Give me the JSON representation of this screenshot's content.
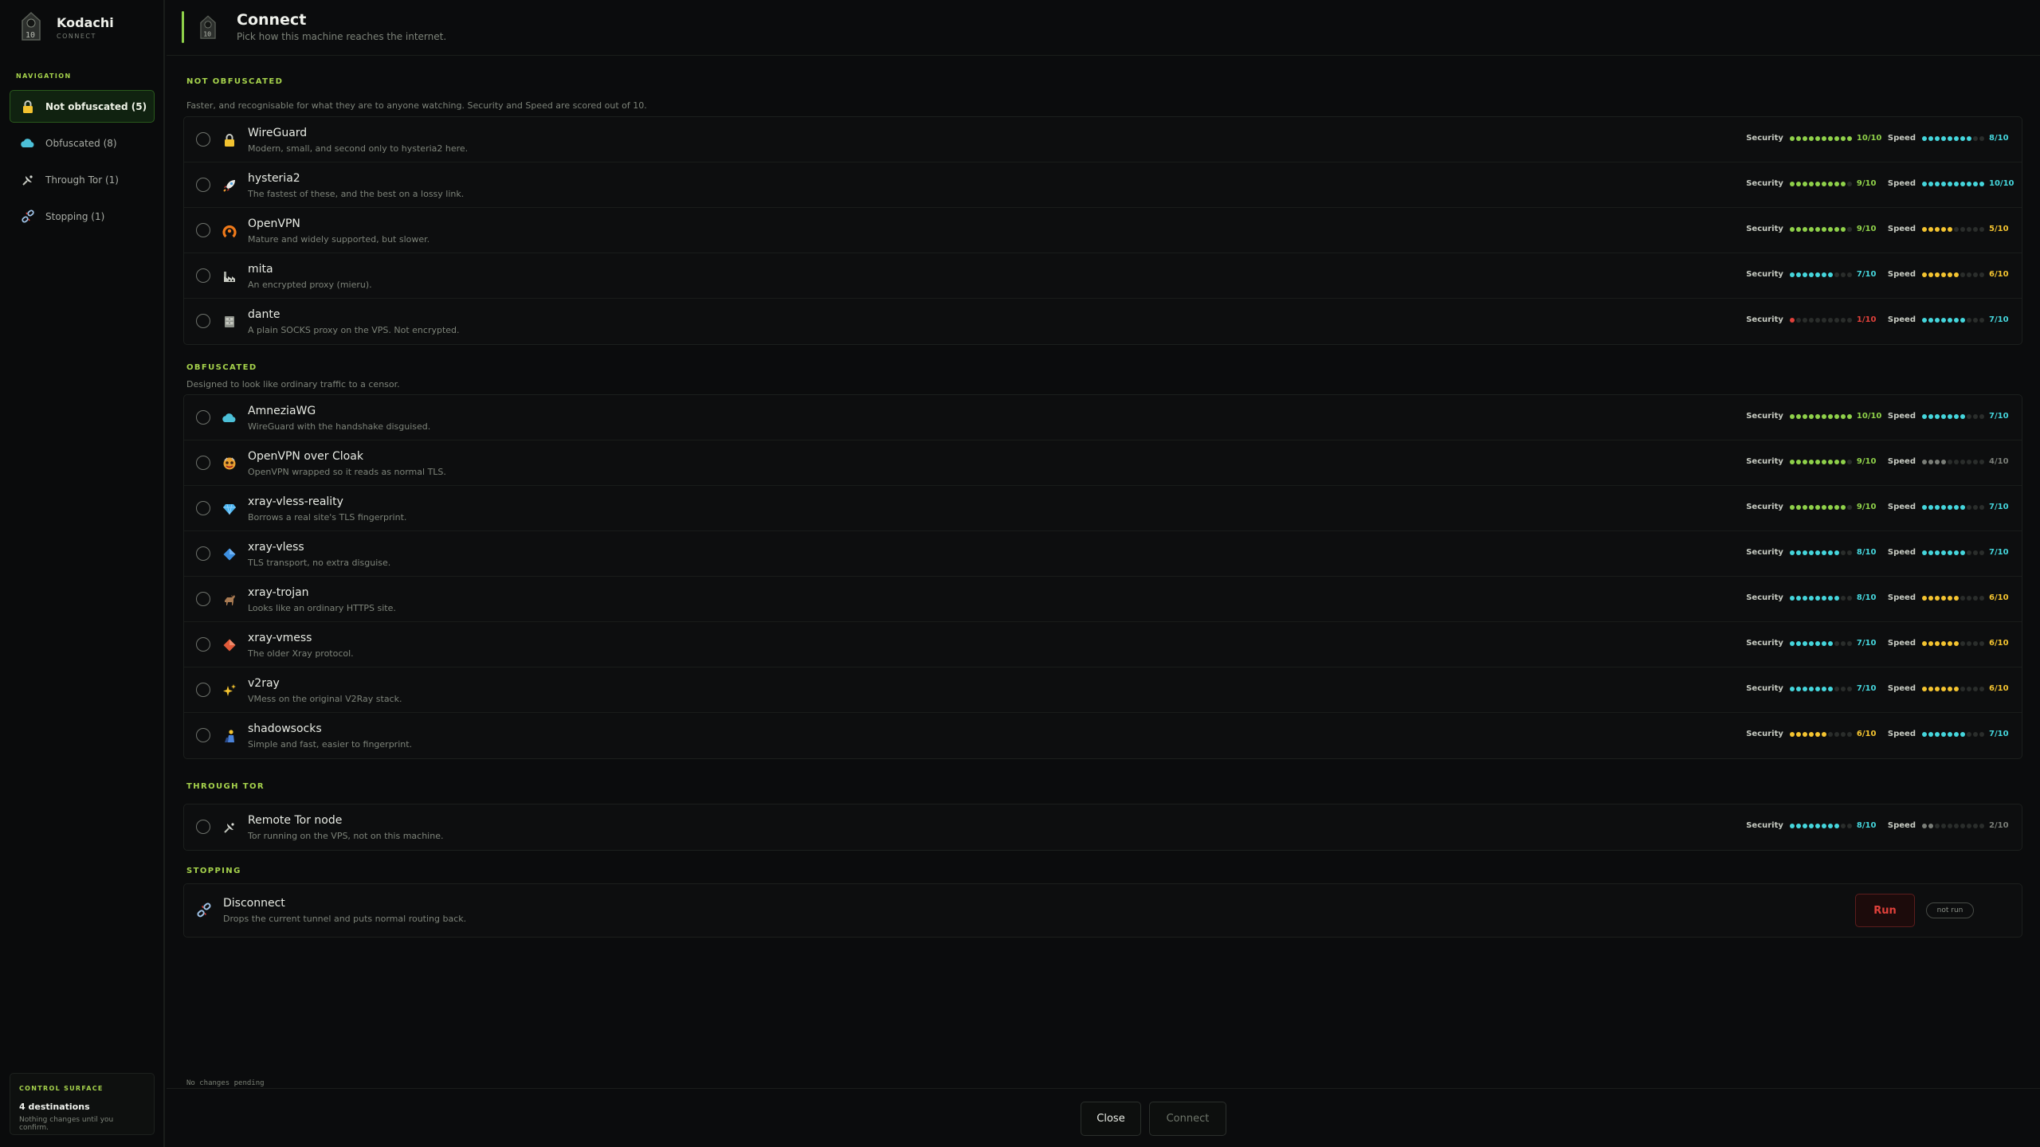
{
  "app": {
    "name": "Kodachi",
    "subtitle": "CONNECT"
  },
  "header": {
    "title": "Connect",
    "subtitle": "Pick how this machine reaches the internet."
  },
  "nav": {
    "heading": "NAVIGATION",
    "items": [
      {
        "label": "Not obfuscated (5)",
        "icon": "lock-icon",
        "active": true
      },
      {
        "label": "Obfuscated (8)",
        "icon": "cloud-icon",
        "active": false
      },
      {
        "label": "Through Tor (1)",
        "icon": "satellite-icon",
        "active": false
      },
      {
        "label": "Stopping (1)",
        "icon": "broken-link-icon",
        "active": false
      }
    ]
  },
  "control_surface": {
    "heading": "CONTROL SURFACE",
    "main": "4 destinations",
    "sub": "Nothing changes until you confirm."
  },
  "labels": {
    "security": "Security",
    "speed": "Speed"
  },
  "colors": {
    "accent": "#a6d34c",
    "green": "#8fd14a",
    "cyan": "#45d6dc",
    "yellow": "#f4c430",
    "gray": "#7a7e78",
    "red": "#e0413b",
    "inactive": "#2a2d2b"
  },
  "sections": [
    {
      "title": "NOT OBFUSCATED",
      "desc": "Faster, and recognisable for what they are to anyone watching. Security and Speed are scored out of 10.",
      "items": [
        {
          "name": "WireGuard",
          "desc": "Modern, small, and second only to hysteria2 here.",
          "icon": "lock-icon",
          "security": 10,
          "speed": 8
        },
        {
          "name": "hysteria2",
          "desc": "The fastest of these, and the best on a lossy link.",
          "icon": "rocket-icon",
          "security": 9,
          "speed": 10
        },
        {
          "name": "OpenVPN",
          "desc": "Mature and widely supported, but slower.",
          "icon": "openvpn-icon",
          "security": 9,
          "speed": 5
        },
        {
          "name": "mita",
          "desc": "An encrypted proxy (mieru).",
          "icon": "factory-icon",
          "security": 7,
          "speed": 6
        },
        {
          "name": "dante",
          "desc": "A plain SOCKS proxy on the VPS. Not encrypted.",
          "icon": "file-cabinet-icon",
          "security": 1,
          "speed": 7
        }
      ]
    },
    {
      "title": "OBFUSCATED",
      "desc": "Designed to look like ordinary traffic to a censor.",
      "items": [
        {
          "name": "AmneziaWG",
          "desc": "WireGuard with the handshake disguised.",
          "icon": "cloud-icon",
          "security": 10,
          "speed": 7
        },
        {
          "name": "OpenVPN over Cloak",
          "desc": "OpenVPN wrapped so it reads as normal TLS.",
          "icon": "mask-icon",
          "security": 9,
          "speed": 4
        },
        {
          "name": "xray-vless-reality",
          "desc": "Borrows a real site's TLS fingerprint.",
          "icon": "gem-icon",
          "security": 9,
          "speed": 7
        },
        {
          "name": "xray-vless",
          "desc": "TLS transport, no extra disguise.",
          "icon": "blue-diamond-icon",
          "security": 8,
          "speed": 7
        },
        {
          "name": "xray-trojan",
          "desc": "Looks like an ordinary HTTPS site.",
          "icon": "horse-icon",
          "security": 8,
          "speed": 6
        },
        {
          "name": "xray-vmess",
          "desc": "The older Xray protocol.",
          "icon": "red-diamond-icon",
          "security": 7,
          "speed": 6
        },
        {
          "name": "v2ray",
          "desc": "VMess on the original V2Ray stack.",
          "icon": "sparkles-icon",
          "security": 7,
          "speed": 6
        },
        {
          "name": "shadowsocks",
          "desc": "Simple and fast, easier to fingerprint.",
          "icon": "shadow-figure-icon",
          "security": 6,
          "speed": 7
        }
      ]
    },
    {
      "title": "THROUGH TOR",
      "desc": "",
      "items": [
        {
          "name": "Remote Tor node",
          "desc": "Tor running on the VPS, not on this machine.",
          "icon": "satellite-icon",
          "security": 8,
          "speed": 2
        }
      ]
    }
  ],
  "stopping": {
    "title": "STOPPING",
    "item": {
      "name": "Disconnect",
      "desc": "Drops the current tunnel and puts normal routing back.",
      "run_label": "Run",
      "status": "not run"
    }
  },
  "footer": {
    "pending": "No changes pending",
    "close_label": "Close",
    "connect_label": "Connect"
  }
}
